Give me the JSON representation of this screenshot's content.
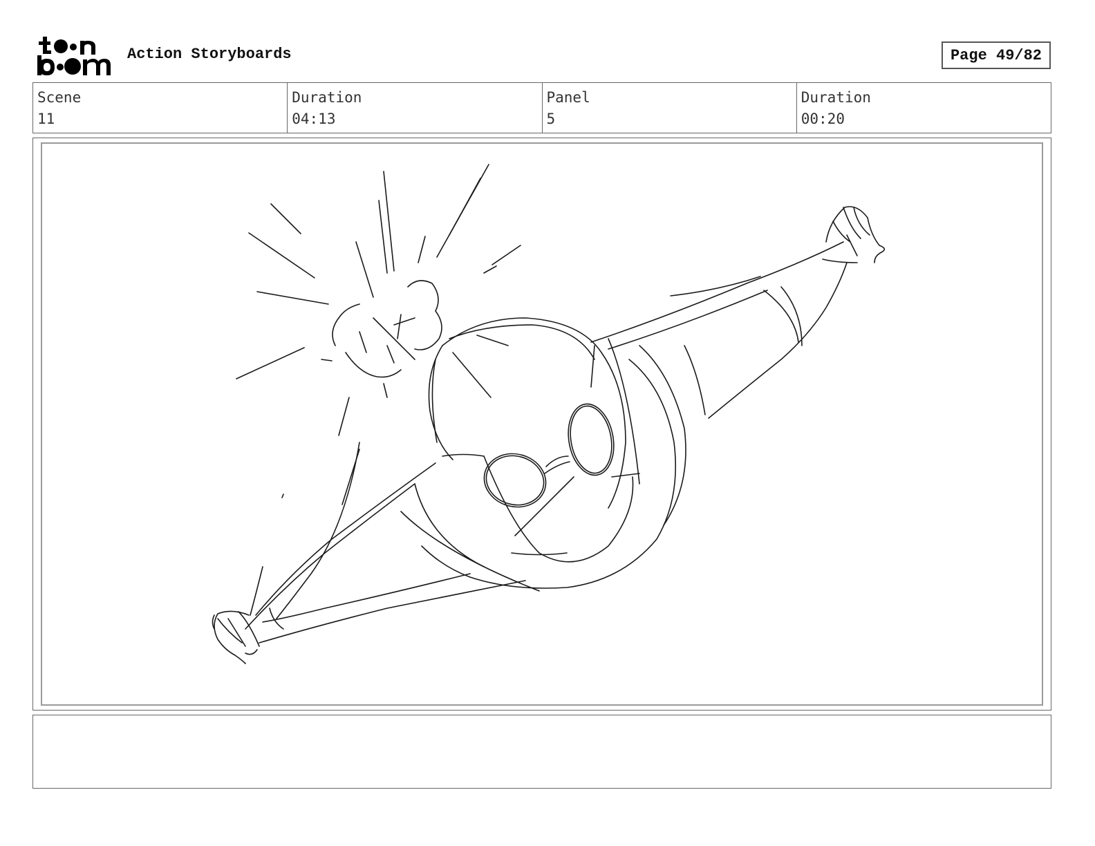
{
  "header": {
    "app_title": "Action Storyboards",
    "page_label": "Page 49/82"
  },
  "logo": {
    "icon": "toon-boom-logo-icon",
    "text": "toon boom"
  },
  "info": {
    "scene_label": "Scene",
    "scene_value": "11",
    "scene_duration_label": "Duration",
    "scene_duration_value": "04:13",
    "panel_label": "Panel",
    "panel_value": "5",
    "panel_duration_label": "Duration",
    "panel_duration_value": "00:20"
  },
  "panel": {
    "sketch_icon": "flying-character-sketch-icon"
  },
  "notes": {
    "text": ""
  }
}
